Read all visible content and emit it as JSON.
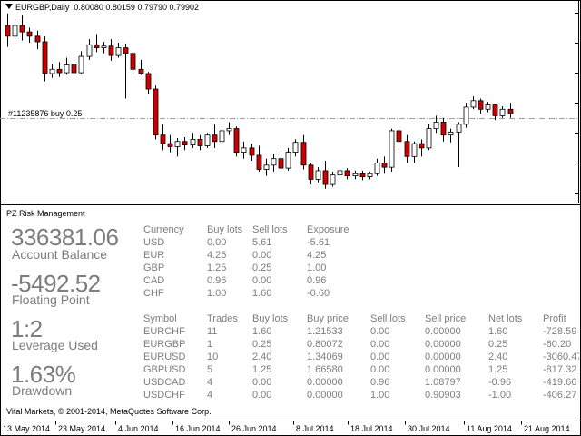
{
  "chart": {
    "header_symbol": "EURGBP,Daily",
    "header_ohlc": "0.80080 0.80159 0.79790 0.79902",
    "order_label": "#11235876 buy 0.25",
    "colors": {
      "bull": "#ffffff",
      "bear": "#cc0000",
      "outline": "#000000",
      "order_line": "#a0a0a0",
      "frame": "#000000"
    },
    "time_labels": [
      "13 May 2014",
      "23 May 2014",
      "4 Jun 2014",
      "16 Jun 2014",
      "26 Jun 2014",
      "8 Jul 2014",
      "18 Jul 2014",
      "30 Jul 2014",
      "11 Aug 2014",
      "21 Aug 2014"
    ],
    "candles": [
      {
        "o": 0.82,
        "h": 0.8228,
        "l": 0.815,
        "c": 0.8175
      },
      {
        "o": 0.8175,
        "h": 0.8215,
        "l": 0.8168,
        "c": 0.82
      },
      {
        "o": 0.82,
        "h": 0.8225,
        "l": 0.8165,
        "c": 0.8185
      },
      {
        "o": 0.8185,
        "h": 0.8195,
        "l": 0.816,
        "c": 0.8175
      },
      {
        "o": 0.8175,
        "h": 0.8188,
        "l": 0.8145,
        "c": 0.8162
      },
      {
        "o": 0.8162,
        "h": 0.8175,
        "l": 0.807,
        "c": 0.8088
      },
      {
        "o": 0.8088,
        "h": 0.811,
        "l": 0.8078,
        "c": 0.8098
      },
      {
        "o": 0.8098,
        "h": 0.8115,
        "l": 0.808,
        "c": 0.809
      },
      {
        "o": 0.809,
        "h": 0.8125,
        "l": 0.8085,
        "c": 0.8108
      },
      {
        "o": 0.8108,
        "h": 0.8125,
        "l": 0.8082,
        "c": 0.809
      },
      {
        "o": 0.809,
        "h": 0.814,
        "l": 0.8088,
        "c": 0.8128
      },
      {
        "o": 0.8128,
        "h": 0.8168,
        "l": 0.812,
        "c": 0.8155
      },
      {
        "o": 0.8155,
        "h": 0.818,
        "l": 0.8138,
        "c": 0.8148
      },
      {
        "o": 0.8148,
        "h": 0.8162,
        "l": 0.8135,
        "c": 0.8152
      },
      {
        "o": 0.8152,
        "h": 0.8168,
        "l": 0.8118,
        "c": 0.813
      },
      {
        "o": 0.813,
        "h": 0.816,
        "l": 0.8125,
        "c": 0.8148
      },
      {
        "o": 0.8148,
        "h": 0.8158,
        "l": 0.803,
        "c": 0.8135
      },
      {
        "o": 0.8135,
        "h": 0.814,
        "l": 0.8085,
        "c": 0.8098
      },
      {
        "o": 0.8098,
        "h": 0.812,
        "l": 0.8085,
        "c": 0.8088
      },
      {
        "o": 0.8088,
        "h": 0.8092,
        "l": 0.804,
        "c": 0.8052
      },
      {
        "o": 0.8052,
        "h": 0.806,
        "l": 0.7935,
        "c": 0.7945
      },
      {
        "o": 0.7945,
        "h": 0.797,
        "l": 0.791,
        "c": 0.7925
      },
      {
        "o": 0.7925,
        "h": 0.7945,
        "l": 0.7905,
        "c": 0.7918
      },
      {
        "o": 0.7918,
        "h": 0.7938,
        "l": 0.7895,
        "c": 0.793
      },
      {
        "o": 0.793,
        "h": 0.794,
        "l": 0.791,
        "c": 0.7922
      },
      {
        "o": 0.7922,
        "h": 0.795,
        "l": 0.7915,
        "c": 0.7935
      },
      {
        "o": 0.7935,
        "h": 0.7945,
        "l": 0.791,
        "c": 0.792
      },
      {
        "o": 0.792,
        "h": 0.795,
        "l": 0.7915,
        "c": 0.7945
      },
      {
        "o": 0.7945,
        "h": 0.797,
        "l": 0.7915,
        "c": 0.793
      },
      {
        "o": 0.793,
        "h": 0.7965,
        "l": 0.7925,
        "c": 0.7955
      },
      {
        "o": 0.7955,
        "h": 0.7975,
        "l": 0.7945,
        "c": 0.796
      },
      {
        "o": 0.796,
        "h": 0.7965,
        "l": 0.7895,
        "c": 0.7905
      },
      {
        "o": 0.7905,
        "h": 0.793,
        "l": 0.789,
        "c": 0.7915
      },
      {
        "o": 0.7915,
        "h": 0.7925,
        "l": 0.7885,
        "c": 0.7898
      },
      {
        "o": 0.7898,
        "h": 0.792,
        "l": 0.786,
        "c": 0.7865
      },
      {
        "o": 0.7865,
        "h": 0.789,
        "l": 0.785,
        "c": 0.7875
      },
      {
        "o": 0.7875,
        "h": 0.79,
        "l": 0.786,
        "c": 0.789
      },
      {
        "o": 0.789,
        "h": 0.791,
        "l": 0.786,
        "c": 0.7868
      },
      {
        "o": 0.7868,
        "h": 0.7915,
        "l": 0.7862,
        "c": 0.7905
      },
      {
        "o": 0.7905,
        "h": 0.7935,
        "l": 0.7895,
        "c": 0.7928
      },
      {
        "o": 0.7928,
        "h": 0.7945,
        "l": 0.7865,
        "c": 0.7875
      },
      {
        "o": 0.7875,
        "h": 0.788,
        "l": 0.783,
        "c": 0.7842
      },
      {
        "o": 0.7842,
        "h": 0.787,
        "l": 0.7835,
        "c": 0.7862
      },
      {
        "o": 0.7862,
        "h": 0.7885,
        "l": 0.782,
        "c": 0.783
      },
      {
        "o": 0.783,
        "h": 0.786,
        "l": 0.7825,
        "c": 0.7852
      },
      {
        "o": 0.7852,
        "h": 0.787,
        "l": 0.784,
        "c": 0.7862
      },
      {
        "o": 0.7862,
        "h": 0.7868,
        "l": 0.7842,
        "c": 0.785
      },
      {
        "o": 0.785,
        "h": 0.7862,
        "l": 0.7842,
        "c": 0.7855
      },
      {
        "o": 0.7855,
        "h": 0.7862,
        "l": 0.784,
        "c": 0.7848
      },
      {
        "o": 0.7848,
        "h": 0.786,
        "l": 0.7842,
        "c": 0.7855
      },
      {
        "o": 0.7855,
        "h": 0.789,
        "l": 0.785,
        "c": 0.788
      },
      {
        "o": 0.788,
        "h": 0.7895,
        "l": 0.7855,
        "c": 0.787
      },
      {
        "o": 0.787,
        "h": 0.796,
        "l": 0.786,
        "c": 0.7955
      },
      {
        "o": 0.7955,
        "h": 0.796,
        "l": 0.791,
        "c": 0.793
      },
      {
        "o": 0.793,
        "h": 0.7945,
        "l": 0.788,
        "c": 0.7895
      },
      {
        "o": 0.7895,
        "h": 0.793,
        "l": 0.788,
        "c": 0.7925
      },
      {
        "o": 0.7925,
        "h": 0.7935,
        "l": 0.7895,
        "c": 0.7915
      },
      {
        "o": 0.7915,
        "h": 0.797,
        "l": 0.791,
        "c": 0.796
      },
      {
        "o": 0.796,
        "h": 0.799,
        "l": 0.795,
        "c": 0.7975
      },
      {
        "o": 0.7975,
        "h": 0.7985,
        "l": 0.793,
        "c": 0.7945
      },
      {
        "o": 0.7945,
        "h": 0.796,
        "l": 0.7928,
        "c": 0.7952
      },
      {
        "o": 0.7952,
        "h": 0.7975,
        "l": 0.787,
        "c": 0.797
      },
      {
        "o": 0.797,
        "h": 0.802,
        "l": 0.7962,
        "c": 0.801
      },
      {
        "o": 0.801,
        "h": 0.8035,
        "l": 0.8005,
        "c": 0.8025
      },
      {
        "o": 0.8025,
        "h": 0.803,
        "l": 0.7995,
        "c": 0.8005
      },
      {
        "o": 0.8005,
        "h": 0.8022,
        "l": 0.7998,
        "c": 0.8015
      },
      {
        "o": 0.8015,
        "h": 0.8018,
        "l": 0.798,
        "c": 0.799
      },
      {
        "o": 0.799,
        "h": 0.8012,
        "l": 0.7985,
        "c": 0.8005
      },
      {
        "o": 0.8005,
        "h": 0.802,
        "l": 0.7985,
        "c": 0.7995
      }
    ]
  },
  "panel": {
    "title": "PZ Risk Management",
    "account_balance": {
      "value": "336381.06",
      "label": "Account Balance"
    },
    "floating_point": {
      "value": "-5492.52",
      "label": "Floating Point"
    },
    "leverage": {
      "value": "1:2",
      "label": "Leverage Used"
    },
    "drawdown": {
      "value": "1.63%",
      "label": "Drawdown"
    },
    "currency_headers": [
      "Currency",
      "Buy lots",
      "Sell lots",
      "Exposure"
    ],
    "currency_rows": [
      [
        "USD",
        "0.00",
        "5.61",
        "-5.61"
      ],
      [
        "EUR",
        "4.25",
        "0.00",
        "4.25"
      ],
      [
        "GBP",
        "1.25",
        "0.25",
        "1.00"
      ],
      [
        "CAD",
        "0.96",
        "0.00",
        "0.96"
      ],
      [
        "CHF",
        "1.00",
        "1.60",
        "-0.60"
      ]
    ],
    "symbol_headers": [
      "Symbol",
      "Trades",
      "Buy lots",
      "Buy price",
      "Sell lots",
      "Sell price",
      "Net lots",
      "Profit"
    ],
    "symbol_rows": [
      [
        "EURCHF",
        "11",
        "1.60",
        "1.21533",
        "0.00",
        "0.00000",
        "1.60",
        "-728.59"
      ],
      [
        "EURGBP",
        "1",
        "0.25",
        "0.80072",
        "0.00",
        "0.00000",
        "0.25",
        "-60.20"
      ],
      [
        "EURUSD",
        "10",
        "2.40",
        "1.34069",
        "0.00",
        "0.00000",
        "2.40",
        "-3060.47"
      ],
      [
        "GBPUSD",
        "5",
        "1.25",
        "1.66580",
        "0.00",
        "0.00000",
        "1.25",
        "-817.32"
      ],
      [
        "USDCAD",
        "4",
        "0.00",
        "0.00000",
        "0.96",
        "1.08797",
        "-0.96",
        "-419.66"
      ],
      [
        "USDCHF",
        "4",
        "0.00",
        "0.00000",
        "1.00",
        "0.90903",
        "-1.00",
        "-406.27"
      ]
    ],
    "footer": "Vital Markets, © 2001-2014, MetaQuotes Software Corp."
  }
}
